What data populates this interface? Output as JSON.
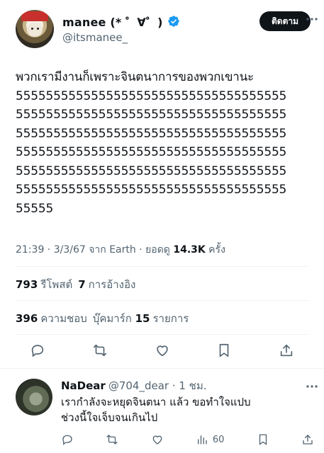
{
  "author": {
    "display_name": "manee (* ゜∀゜)",
    "handle": "@itsmanee_",
    "follow_label": "ติดตาม"
  },
  "tweet": {
    "lines": [
      "พวกเรามีงานก็เพราะจินตนาการของพวกเขานะ",
      "555555555555555555555555555555555555",
      "555555555555555555555555555555555555",
      "555555555555555555555555555555555555",
      "555555555555555555555555555555555555",
      "555555555555555555555555555555555555",
      "555555555555555555555555555555555555",
      "55555"
    ],
    "time": "21:39 · 3/3/67 จาก Earth · ยอดดู ",
    "views": "14.3K",
    "views_suffix": " ครั้ง"
  },
  "stats": {
    "retweets_count": "793",
    "retweets_label": "รีโพสต์",
    "quotes_count": "7",
    "quotes_label": "การอ้างอิง",
    "likes_count": "396",
    "likes_label": "ความชอบ",
    "bookmarks_label": "บุ๊คมาร์ก",
    "bookmarks_count": "15",
    "bookmarks_suffix": "รายการ"
  },
  "reply": {
    "name": "NaDear",
    "handle_time": "@704_dear · 1 ชม.",
    "line1": "เรากำลังจะหยุดจินตนา แล้ว  ขอทำใจแปบ",
    "line2": "ช่วงนี้ใจเจ็บจนเกินไป",
    "views": "60"
  },
  "colors": {
    "text": "#0f1419",
    "secondary": "#536471",
    "verified": "#1d9bf0",
    "button_bg": "#0f1419"
  }
}
